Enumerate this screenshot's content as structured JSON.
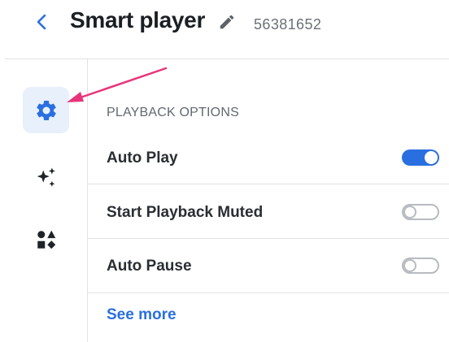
{
  "header": {
    "title": "Smart player",
    "player_id": "56381652",
    "back_icon": "chevron-left-icon",
    "edit_icon": "pencil-icon"
  },
  "sidebar": {
    "items": [
      {
        "name": "settings",
        "icon": "gear-icon",
        "active": true
      },
      {
        "name": "ai-features",
        "icon": "sparkles-icon",
        "active": false
      },
      {
        "name": "elements",
        "icon": "shapes-icon",
        "active": false
      }
    ]
  },
  "playback": {
    "heading": "PLAYBACK OPTIONS",
    "options": [
      {
        "label": "Auto Play",
        "enabled": true
      },
      {
        "label": "Start Playback Muted",
        "enabled": false
      },
      {
        "label": "Auto Pause",
        "enabled": false
      }
    ],
    "see_more": "See more"
  },
  "colors": {
    "accent": "#2a6fe0",
    "annotation": "#e8357a",
    "active_bg": "#e8f0fc"
  }
}
